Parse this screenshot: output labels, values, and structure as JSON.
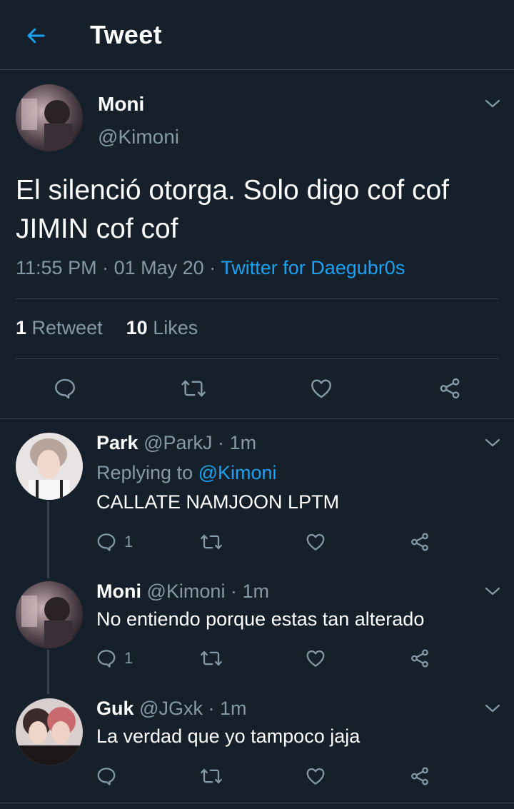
{
  "header": {
    "title": "Tweet",
    "back_icon": "arrow-left-icon"
  },
  "accent": "#1da1f2",
  "main_tweet": {
    "name": "Moni",
    "handle": "@Kimoni",
    "text": "El silenció otorga. Solo digo cof cof JIMIN cof cof",
    "time": "11:55 PM",
    "date": "01 May 20",
    "source": "Twitter for Daegubr0s",
    "retweets_count": "1",
    "retweets_label": "Retweet",
    "likes_count": "10",
    "likes_label": "Likes"
  },
  "replies": [
    {
      "name": "Park",
      "handle": "@ParkJ",
      "age": "1m",
      "replying_prefix": "Replying to",
      "replying_to": "@Kimoni",
      "text": "CALLATE NAMJOON LPTM",
      "reply_count": "1"
    },
    {
      "name": "Moni",
      "handle": "@Kimoni",
      "age": "1m",
      "text": "No entiendo porque estas tan alterado",
      "reply_count": "1"
    },
    {
      "name": "Guk",
      "handle": "@JGxk",
      "age": "1m",
      "text": "La verdad que yo tampoco jaja",
      "reply_count": ""
    }
  ],
  "separator": "·"
}
